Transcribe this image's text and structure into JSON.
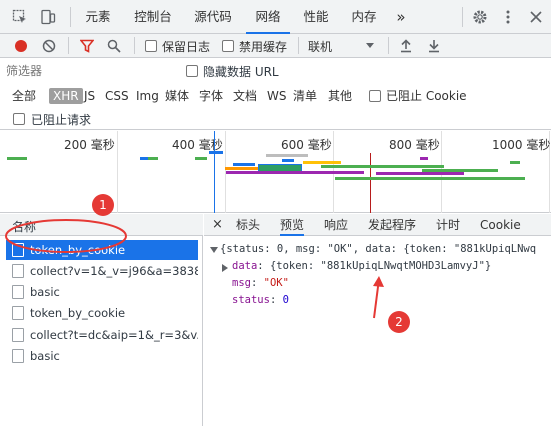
{
  "tabs": [
    {
      "label": "元素"
    },
    {
      "label": "控制台"
    },
    {
      "label": "源代码"
    },
    {
      "label": "网络"
    },
    {
      "label": "性能"
    },
    {
      "label": "内存"
    },
    {
      "label": "»"
    }
  ],
  "network_toolbar": {
    "preserve_log": "保留日志",
    "disable_cache": "禁用缓存",
    "throttling": "联机"
  },
  "filter": {
    "placeholder": "筛选器",
    "hide_data_urls": "隐藏数据 URL"
  },
  "type_filters": [
    "全部",
    "XHR",
    "JS",
    "CSS",
    "Img",
    "媒体",
    "字体",
    "文档",
    "WS",
    "清单",
    "其他"
  ],
  "blocked_cookies": "已阻止 Cookie",
  "blocked_requests": "已阻止请求",
  "timeline_ticks": [
    "200 毫秒",
    "400 毫秒",
    "600 毫秒",
    "800 毫秒",
    "1000 毫秒"
  ],
  "request_list": {
    "header": "名称",
    "rows": [
      "token_by_cookie",
      "collect?v=1&_v=j96&a=3838...",
      "basic",
      "token_by_cookie",
      "collect?t=dc&aip=1&_r=3&v...",
      "basic"
    ]
  },
  "detail_tabs": [
    "×",
    "标头",
    "预览",
    "响应",
    "发起程序",
    "计时",
    "Cookie"
  ],
  "preview": {
    "line1_prefix": "{status: 0, msg: \"OK\", data: {token: \"881kUpiqLNwq",
    "line2_key": "data",
    "line2_value": "{token: \"881kUpiqLNwqtMOHD3LamvyJ\"}",
    "msg_key": "msg",
    "msg_value": "\"OK\"",
    "status_key": "status",
    "status_value": "0"
  },
  "annotations": [
    "1",
    "2"
  ],
  "colors": {
    "accent": "#1a73e8",
    "annotation": "#e53935"
  }
}
